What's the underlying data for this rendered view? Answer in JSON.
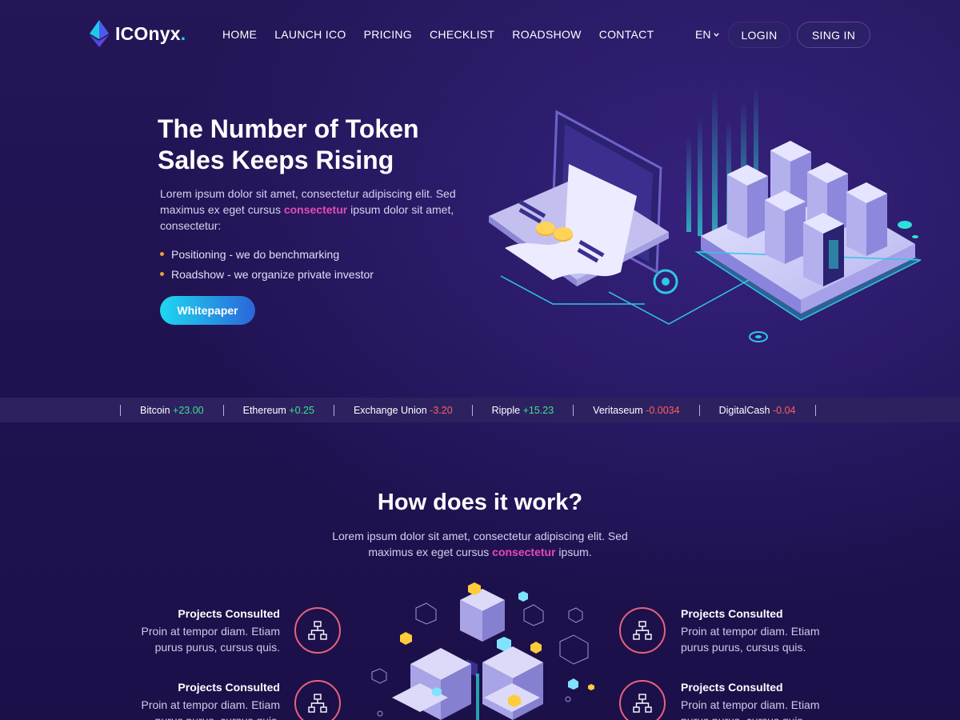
{
  "brand": {
    "name": "ICOnyx",
    "dot": ".",
    "accent": "#23d5e8"
  },
  "nav": {
    "items": [
      "HOME",
      "LAUNCH ICO",
      "PRICING",
      "CHECKLIST",
      "ROADSHOW",
      "CONTACT"
    ],
    "lang": "EN",
    "login": "LOGIN",
    "signin": "SING IN"
  },
  "hero": {
    "title": "The Number of Token Sales Keeps Rising",
    "desc_before": "Lorem ipsum dolor sit amet, consectetur adipiscing elit. Sed maximus ex eget cursus ",
    "desc_highlight": "consectetur",
    "desc_after": " ipsum dolor sit amet, consectetur:",
    "bullets": [
      "Positioning - we do benchmarking",
      "Roadshow - we organize private investor"
    ],
    "cta": "Whitepaper"
  },
  "ticker": [
    {
      "name": "Bitcoin",
      "change": "+23.00",
      "dir": "up"
    },
    {
      "name": "Ethereum",
      "change": "+0.25",
      "dir": "up"
    },
    {
      "name": "Exchange Union",
      "change": "-3.20",
      "dir": "down"
    },
    {
      "name": "Ripple",
      "change": "+15.23",
      "dir": "up"
    },
    {
      "name": "Veritaseum",
      "change": "-0.0034",
      "dir": "down"
    },
    {
      "name": "DigitalCash",
      "change": "-0.04",
      "dir": "down"
    }
  ],
  "how": {
    "title": "How does it work?",
    "desc_before": "Lorem ipsum dolor sit amet, consectetur adipiscing elit. Sed maximus ex eget cursus ",
    "desc_highlight": "consectetur",
    "desc_after": " ipsum.",
    "features": [
      {
        "title": "Projects Consulted",
        "desc": "Proin at tempor diam. Etiam purus purus, cursus quis."
      },
      {
        "title": "Projects Consulted",
        "desc": "Proin at tempor diam. Etiam purus purus, cursus quis."
      },
      {
        "title": "Projects Consulted",
        "desc": "Proin at tempor diam. Etiam purus purus, cursus quis."
      },
      {
        "title": "Projects Consulted",
        "desc": "Proin at tempor diam. Etiam purus purus, cursus quis."
      }
    ]
  },
  "colors": {
    "up": "#3ee08c",
    "down": "#ff6060",
    "highlight": "#e54bb6",
    "bullet": "#f29a3c"
  }
}
